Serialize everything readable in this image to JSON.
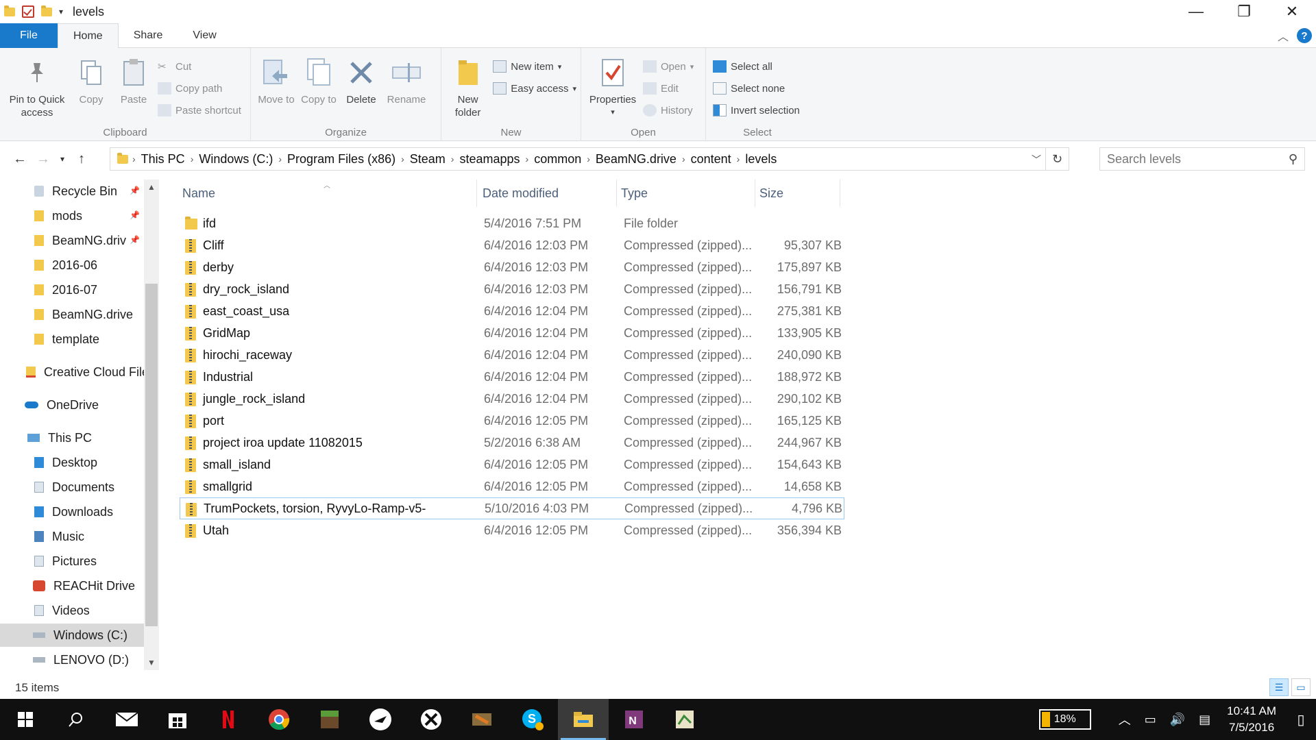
{
  "window": {
    "title": "levels",
    "controls": {
      "minimize": "—",
      "maximize": "❐",
      "close": "✕"
    }
  },
  "ribbon_tabs": [
    "File",
    "Home",
    "Share",
    "View"
  ],
  "ribbon": {
    "clipboard": {
      "label": "Clipboard",
      "pin": "Pin to Quick access",
      "copy": "Copy",
      "paste": "Paste",
      "cut": "Cut",
      "copy_path": "Copy path",
      "paste_shortcut": "Paste shortcut"
    },
    "organize": {
      "label": "Organize",
      "move_to": "Move to",
      "copy_to": "Copy to",
      "delete": "Delete",
      "rename": "Rename"
    },
    "new": {
      "label": "New",
      "new_folder": "New folder",
      "new_item": "New item",
      "easy_access": "Easy access"
    },
    "open": {
      "label": "Open",
      "properties": "Properties",
      "open": "Open",
      "edit": "Edit",
      "history": "History"
    },
    "select": {
      "label": "Select",
      "select_all": "Select all",
      "select_none": "Select none",
      "invert": "Invert selection"
    }
  },
  "address": {
    "crumbs": [
      "This PC",
      "Windows (C:)",
      "Program Files (x86)",
      "Steam",
      "steamapps",
      "common",
      "BeamNG.drive",
      "content",
      "levels"
    ],
    "search_placeholder": "Search levels"
  },
  "nav_pane": [
    {
      "label": "Recycle Bin",
      "icon": "recycle-bin-icon",
      "pinned": true
    },
    {
      "label": "mods",
      "icon": "folder-icon",
      "pinned": true
    },
    {
      "label": "BeamNG.drive",
      "icon": "folder-icon",
      "pinned": true
    },
    {
      "label": "2016-06",
      "icon": "folder-icon",
      "pinned": false
    },
    {
      "label": "2016-07",
      "icon": "folder-icon",
      "pinned": false
    },
    {
      "label": "BeamNG.drive",
      "icon": "folder-icon",
      "pinned": false
    },
    {
      "label": "template",
      "icon": "folder-icon",
      "pinned": false
    },
    {
      "label": "Creative Cloud Files",
      "icon": "creative-cloud-icon",
      "pinned": false
    },
    {
      "label": "OneDrive",
      "icon": "onedrive-icon",
      "pinned": false
    },
    {
      "label": "This PC",
      "icon": "computer-icon",
      "pinned": false
    },
    {
      "label": "Desktop",
      "icon": "desktop-icon",
      "pinned": false
    },
    {
      "label": "Documents",
      "icon": "documents-icon",
      "pinned": false
    },
    {
      "label": "Downloads",
      "icon": "downloads-icon",
      "pinned": false
    },
    {
      "label": "Music",
      "icon": "music-icon",
      "pinned": false
    },
    {
      "label": "Pictures",
      "icon": "pictures-icon",
      "pinned": false
    },
    {
      "label": "REACHit Drive",
      "icon": "reachit-icon",
      "pinned": false
    },
    {
      "label": "Videos",
      "icon": "videos-icon",
      "pinned": false
    },
    {
      "label": "Windows (C:)",
      "icon": "drive-icon",
      "pinned": false,
      "selected": true
    },
    {
      "label": "LENOVO (D:)",
      "icon": "drive-icon",
      "pinned": false
    }
  ],
  "columns": [
    "Name",
    "Date modified",
    "Type",
    "Size"
  ],
  "files": [
    {
      "name": "ifd",
      "date": "5/4/2016 7:51 PM",
      "type": "File folder",
      "size": "",
      "kind": "folder"
    },
    {
      "name": "Cliff",
      "date": "6/4/2016 12:03 PM",
      "type": "Compressed (zipped)...",
      "size": "95,307 KB",
      "kind": "zip"
    },
    {
      "name": "derby",
      "date": "6/4/2016 12:03 PM",
      "type": "Compressed (zipped)...",
      "size": "175,897 KB",
      "kind": "zip"
    },
    {
      "name": "dry_rock_island",
      "date": "6/4/2016 12:03 PM",
      "type": "Compressed (zipped)...",
      "size": "156,791 KB",
      "kind": "zip"
    },
    {
      "name": "east_coast_usa",
      "date": "6/4/2016 12:04 PM",
      "type": "Compressed (zipped)...",
      "size": "275,381 KB",
      "kind": "zip"
    },
    {
      "name": "GridMap",
      "date": "6/4/2016 12:04 PM",
      "type": "Compressed (zipped)...",
      "size": "133,905 KB",
      "kind": "zip"
    },
    {
      "name": "hirochi_raceway",
      "date": "6/4/2016 12:04 PM",
      "type": "Compressed (zipped)...",
      "size": "240,090 KB",
      "kind": "zip"
    },
    {
      "name": "Industrial",
      "date": "6/4/2016 12:04 PM",
      "type": "Compressed (zipped)...",
      "size": "188,972 KB",
      "kind": "zip"
    },
    {
      "name": "jungle_rock_island",
      "date": "6/4/2016 12:04 PM",
      "type": "Compressed (zipped)...",
      "size": "290,102 KB",
      "kind": "zip"
    },
    {
      "name": "port",
      "date": "6/4/2016 12:05 PM",
      "type": "Compressed (zipped)...",
      "size": "165,125 KB",
      "kind": "zip"
    },
    {
      "name": "project iroa update 11082015",
      "date": "5/2/2016 6:38 AM",
      "type": "Compressed (zipped)...",
      "size": "244,967 KB",
      "kind": "zip"
    },
    {
      "name": "small_island",
      "date": "6/4/2016 12:05 PM",
      "type": "Compressed (zipped)...",
      "size": "154,643 KB",
      "kind": "zip"
    },
    {
      "name": "smallgrid",
      "date": "6/4/2016 12:05 PM",
      "type": "Compressed (zipped)...",
      "size": "14,658 KB",
      "kind": "zip"
    },
    {
      "name": "TrumPockets, torsion, RyvyLo-Ramp-v5-",
      "date": "5/10/2016 4:03 PM",
      "type": "Compressed (zipped)...",
      "size": "4,796 KB",
      "kind": "zip",
      "focused": true
    },
    {
      "name": "Utah",
      "date": "6/4/2016 12:05 PM",
      "type": "Compressed (zipped)...",
      "size": "356,394 KB",
      "kind": "zip"
    }
  ],
  "status": {
    "item_count": "15 items"
  },
  "taskbar": {
    "apps": [
      "start-icon",
      "search-icon",
      "mail-icon",
      "store-icon",
      "netflix-icon",
      "chrome-icon",
      "minecraft-icon",
      "forza-icon",
      "xbox-icon",
      "game-icon",
      "skype-icon",
      "file-explorer-icon",
      "onenote-icon",
      "app-icon"
    ],
    "active_app": "file-explorer-icon",
    "battery": "18%",
    "time": "10:41 AM",
    "date": "7/5/2016"
  },
  "colors": {
    "accent": "#1979ca",
    "folder": "#f2c94c",
    "taskbar": "#101010"
  }
}
